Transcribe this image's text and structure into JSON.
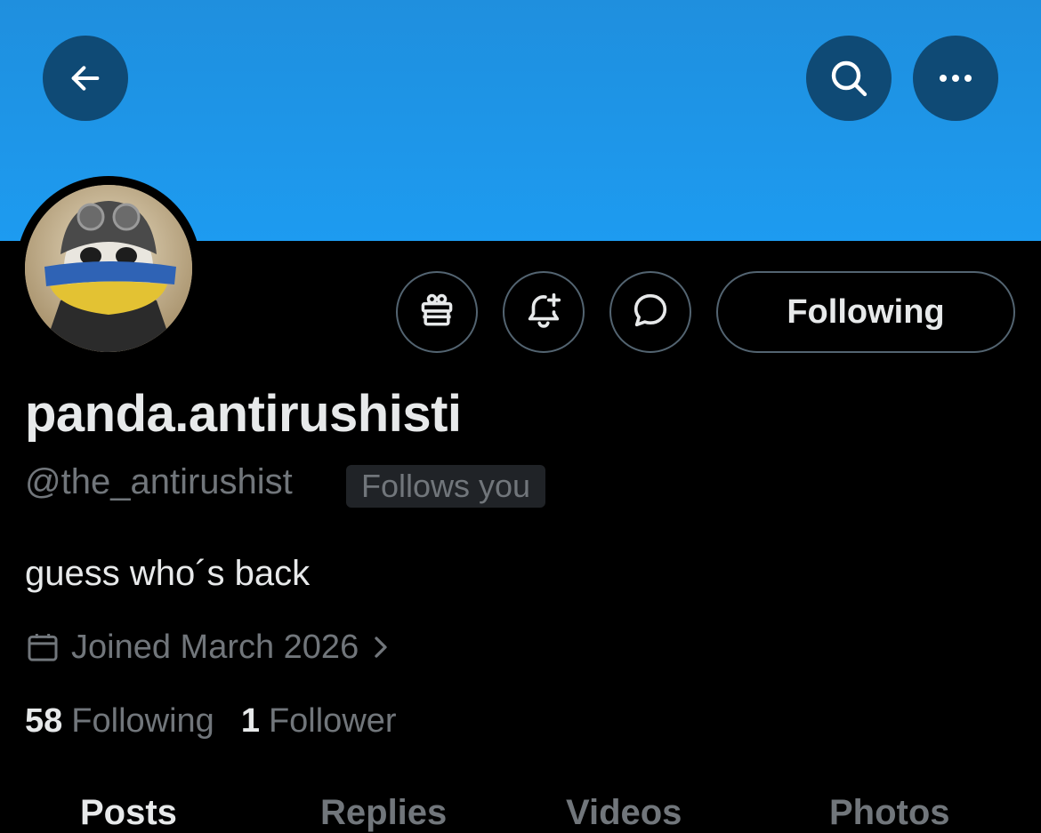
{
  "header": {
    "back_icon": "arrow-left-icon",
    "search_icon": "search-icon",
    "more_icon": "more-horizontal-icon",
    "banner_color": "#1d9bf0"
  },
  "actions": {
    "gift_icon": "gift-icon",
    "notify_icon": "bell-plus-icon",
    "message_icon": "chat-bubble-icon",
    "following_label": "Following"
  },
  "profile": {
    "display_name": "panda.antirushisti",
    "handle": "@the_antirushist",
    "follows_you": "Follows you",
    "bio": "guess who´s back",
    "joined": "Joined March 2026",
    "following_count": "58",
    "following_label": "Following",
    "followers_count": "1",
    "followers_label": "Follower"
  },
  "tabs": [
    {
      "label": "Posts"
    },
    {
      "label": "Replies"
    },
    {
      "label": "Videos"
    },
    {
      "label": "Photos"
    }
  ]
}
